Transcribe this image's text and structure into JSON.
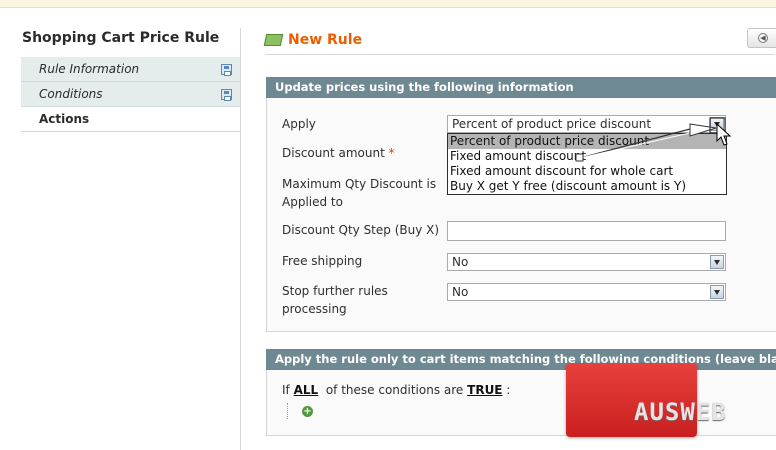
{
  "sidebar": {
    "title": "Shopping Cart Price Rule",
    "tabs": [
      {
        "label": "Rule Information"
      },
      {
        "label": "Conditions"
      },
      {
        "label": "Actions"
      }
    ]
  },
  "header": {
    "title": "New Rule"
  },
  "actions_fieldset": {
    "legend": "Update prices using the following information",
    "apply_label": "Apply",
    "apply_value": "Percent of product price discount",
    "apply_options": [
      "Percent of product price discount",
      "Fixed amount discount",
      "Fixed amount discount for whole cart",
      "Buy X get Y free (discount amount is Y)"
    ],
    "discount_amount_label": "Discount amount",
    "required_mark": "*",
    "max_qty_label_line1": "Maximum Qty Discount is",
    "max_qty_label_line2": "Applied to",
    "qty_step_label": "Discount Qty Step (Buy X)",
    "free_shipping_label": "Free shipping",
    "free_shipping_value": "No",
    "stop_rules_label_line1": "Stop further rules",
    "stop_rules_label_line2": "processing",
    "stop_rules_value": "No"
  },
  "conditions_fieldset": {
    "legend": "Apply the rule only to cart items matching the following conditions (leave blank for all items)",
    "if_text": "If",
    "aggregator": "ALL",
    "middle_text": "of these conditions are",
    "value": "TRUE",
    "colon": ":"
  },
  "logo": {
    "text": "AUSWEB"
  },
  "colors": {
    "fieldset_header": "#6f8992",
    "title_orange": "#eb5e00",
    "tab_inactive_bg": "#e5ecec",
    "logo_red": "#d8302e"
  }
}
